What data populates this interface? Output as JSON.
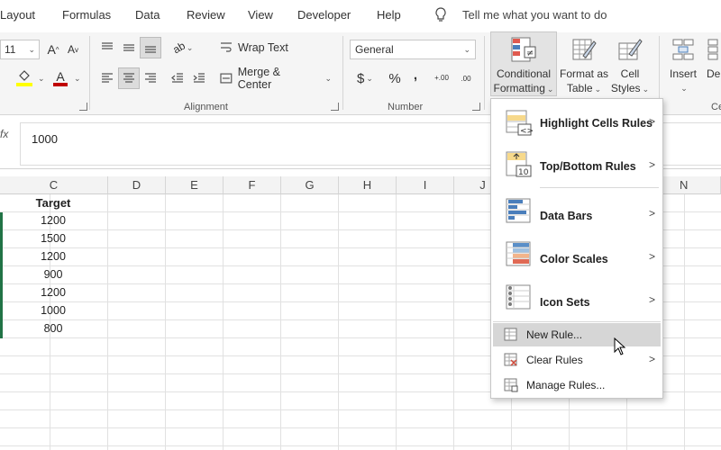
{
  "tabs": {
    "items": [
      {
        "label": "Layout"
      },
      {
        "label": "Formulas"
      },
      {
        "label": "Data"
      },
      {
        "label": "Review"
      },
      {
        "label": "View"
      },
      {
        "label": "Developer"
      },
      {
        "label": "Help"
      }
    ],
    "tell_me": "Tell me what you want to do"
  },
  "ribbon": {
    "font_size": "11",
    "wrap_text": "Wrap Text",
    "merge_center": "Merge & Center",
    "number_format": "General",
    "currency_symbol": "$",
    "percent_symbol": "%",
    "comma_symbol": ",",
    "increase_decimal": "+.00",
    "decrease_decimal": ".00",
    "groups": {
      "alignment": "Alignment",
      "number": "Number"
    },
    "conditional_formatting": {
      "line1": "Conditional",
      "line2": "Formatting"
    },
    "format_as_table": {
      "line1": "Format as",
      "line2": "Table"
    },
    "cell_styles": {
      "line1": "Cell",
      "line2": "Styles"
    },
    "insert": "Insert",
    "delete_partial": "Del",
    "cells_group_partial": "Ce",
    "accent_color": "#217346",
    "font_color_bar": "#c00000",
    "highlight_bar": "#ffff00"
  },
  "formula_bar": {
    "fx": "fx",
    "value": "1000"
  },
  "sheet": {
    "columns": [
      "C",
      "D",
      "E",
      "F",
      "G",
      "H",
      "I",
      "J",
      "N"
    ],
    "column_c_header": "Target",
    "column_c_values": [
      "1200",
      "1500",
      "1200",
      "900",
      "1200",
      "1000",
      "800"
    ]
  },
  "cf_menu": {
    "items": [
      {
        "label": "Highlight Cells Rules",
        "icon": "highlight-cells-icon"
      },
      {
        "label": "Top/Bottom Rules",
        "icon": "top-bottom-icon"
      },
      {
        "label": "Data Bars",
        "icon": "data-bars-icon"
      },
      {
        "label": "Color Scales",
        "icon": "color-scales-icon"
      },
      {
        "label": "Icon Sets",
        "icon": "icon-sets-icon"
      }
    ],
    "new_rule": "New Rule...",
    "clear_rules": "Clear Rules",
    "manage_rules": "Manage Rules..."
  }
}
